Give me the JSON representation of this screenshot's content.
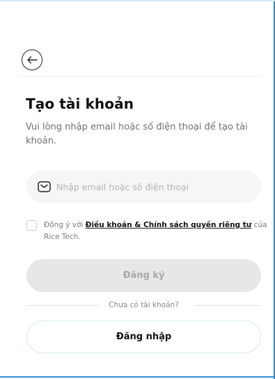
{
  "header": {
    "back_icon": "arrow-left-icon"
  },
  "main": {
    "title": "Tạo tài khoản",
    "subtitle": "Vui lòng nhập email hoặc số điện thoại để tạo tài khoản.",
    "input": {
      "icon": "mail-icon",
      "value": "",
      "placeholder": "Nhập email hoặc số điện thoại"
    },
    "agreement": {
      "checked": false,
      "prefix": "Đồng ý với ",
      "link_text": "Điều khoản & Chính sách quyền riêng tư",
      "suffix": " của Rice Tech."
    },
    "register_label": "Đăng ký",
    "no_account_text": "Chưa có tài khoản?",
    "login_label": "Đăng nhập"
  },
  "colors": {
    "accent_border": "#2f86cf",
    "register_bg_disabled": "#e7e7e7",
    "login_border": "#d3ece9"
  }
}
